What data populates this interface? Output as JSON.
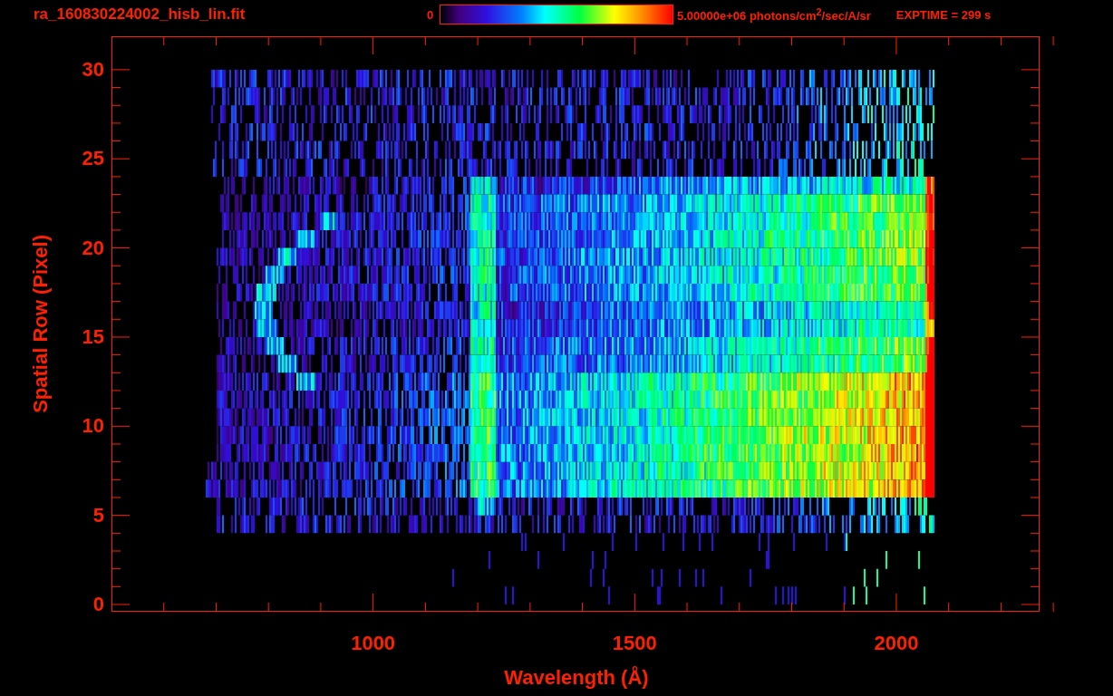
{
  "header": {
    "title": "ra_160830224002_hisb_lin.fit",
    "colorbar_min": "0",
    "colorbar_max": "5.00000e+06 photons/cm$^{2}$/sec/A/sr",
    "exposure": "EXPTIME = 299 s"
  },
  "y_axis": {
    "label": "Spatial Row (Pixel)",
    "ticks": [
      "30",
      "25",
      "20",
      "15",
      "10",
      "5",
      "0"
    ]
  },
  "x_axis": {
    "label": "Wavelength (Å)",
    "ticks": [
      "1000",
      "1500",
      "2000"
    ]
  }
}
